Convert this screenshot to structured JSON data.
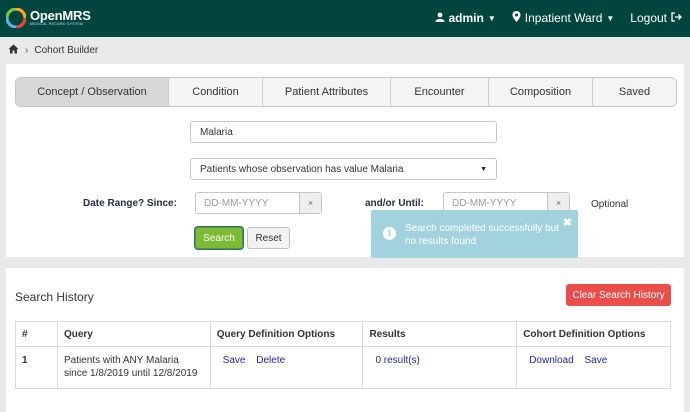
{
  "header": {
    "logo_text": "OpenMRS",
    "logo_sub": "MEDICAL RECORD SYSTEM",
    "user_label": "admin",
    "location_label": "Inpatient Ward",
    "logout_label": "Logout",
    "bg_color": "#00463f"
  },
  "breadcrumb": {
    "home_icon": "home-icon",
    "current": "Cohort Builder"
  },
  "tabs": [
    {
      "label": "Concept / Observation",
      "active": true
    },
    {
      "label": "Condition",
      "active": false
    },
    {
      "label": "Patient Attributes",
      "active": false
    },
    {
      "label": "Encounter",
      "active": false
    },
    {
      "label": "Composition",
      "active": false
    },
    {
      "label": "Saved",
      "active": false
    }
  ],
  "form": {
    "concept_value": "Malaria",
    "observation_select": "Patients whose observation has value Malaria",
    "date_since_label": "Date Range? Since:",
    "date_since_placeholder": "DD-MM-YYYY",
    "date_until_label": "and/or Until:",
    "date_until_placeholder": "DD-MM-YYYY",
    "clear_glyph": "×",
    "optional_label": "Optional",
    "search_label": "Search",
    "reset_label": "Reset"
  },
  "toast": {
    "message": "Search completed successfully but no results found",
    "close_glyph": "✖",
    "icon_glyph": "i",
    "color": "#a3d2df"
  },
  "history": {
    "title": "Search History",
    "clear_label": "Clear Search History",
    "columns": [
      "#",
      "Query",
      "Query Definition Options",
      "Results",
      "Cohort Definition Options"
    ],
    "rows": [
      {
        "num": "1",
        "query": "Patients with ANY Malaria since 1/8/2019 until 12/8/2019",
        "save_label": "Save",
        "delete_label": "Delete",
        "results": "0 result(s)",
        "download_label": "Download",
        "cohort_save_label": "Save"
      }
    ]
  }
}
